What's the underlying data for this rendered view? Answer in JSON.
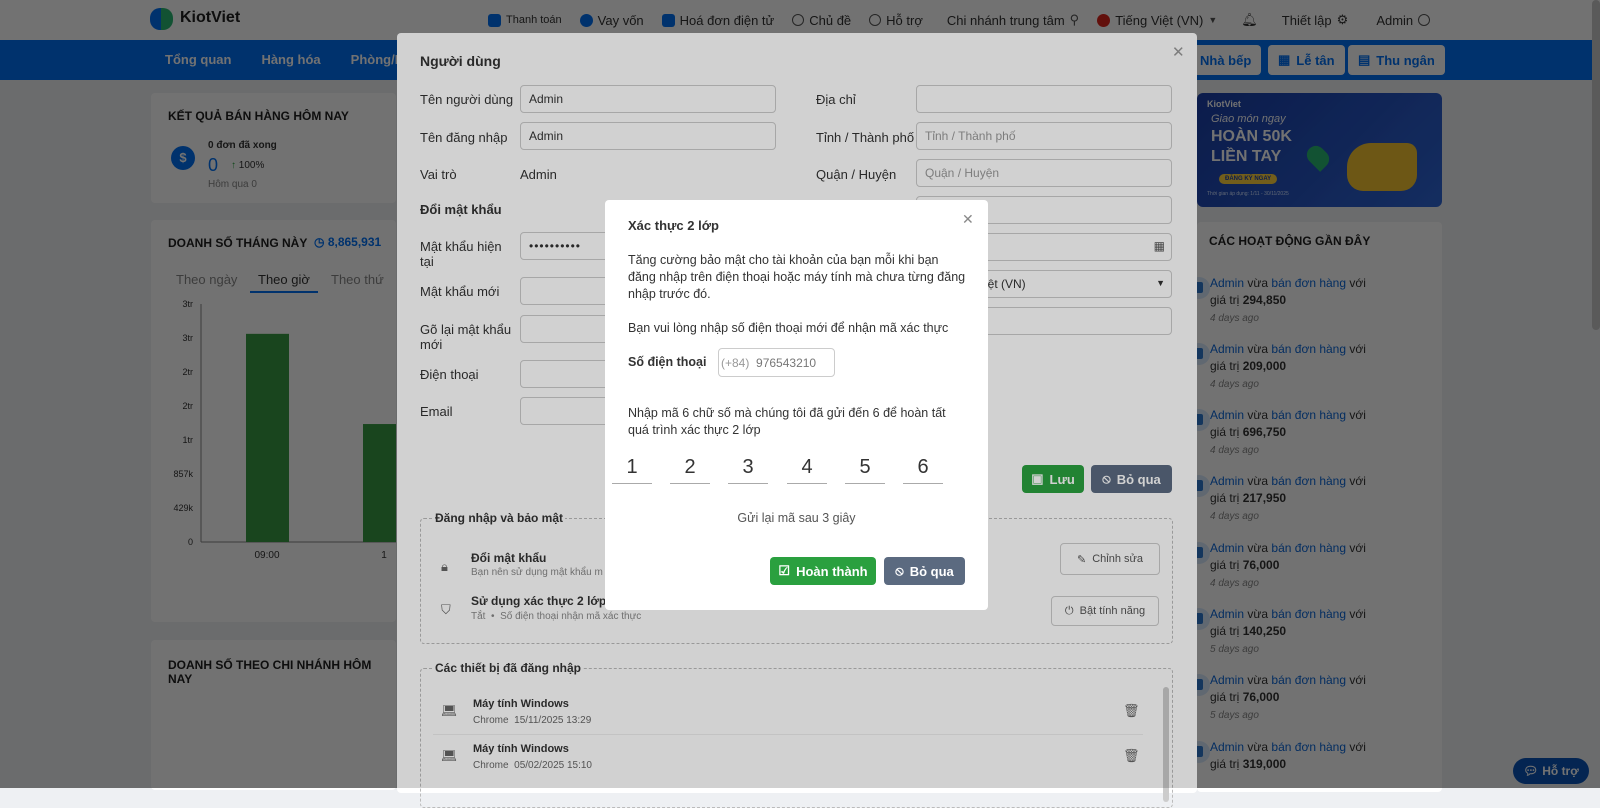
{
  "header": {
    "brand": "KiotViet",
    "nav": [
      "Thanh toán",
      "Vay vốn",
      "Hoá đơn điện tử",
      "Chủ đề",
      "Hỗ trợ",
      "Chi nhánh trung tâm",
      "Tiếng Việt (VN)",
      "Thiết lập",
      "Admin"
    ]
  },
  "mainbar": {
    "menu": [
      "Tổng quan",
      "Hàng hóa",
      "Phòng/Bàn"
    ],
    "buttons": [
      "Nhà bếp",
      "Lễ tân",
      "Thu ngân"
    ]
  },
  "sales_today": {
    "title": "KẾT QUẢ BÁN HÀNG HÔM NAY",
    "orders": "0 đơn đã xong",
    "amount": "0",
    "pct": "100%",
    "yesterday": "Hôm qua 0"
  },
  "monthly": {
    "title": "DOANH SỐ THÁNG NÀY",
    "total": "8,865,931",
    "tabs": [
      "Theo ngày",
      "Theo giờ",
      "Theo thứ"
    ]
  },
  "chart_data": {
    "type": "bar",
    "categories": [
      "09:00",
      "1"
    ],
    "values": [
      3000000,
      1700000
    ],
    "yticks": [
      "0",
      "429k",
      "857k",
      "1tr",
      "2tr",
      "2tr",
      "3tr",
      "3tr"
    ],
    "ylim": [
      0,
      3430000
    ]
  },
  "branch": {
    "title": "DOANH SỐ THEO CHI NHÁNH HÔM NAY"
  },
  "promo": {
    "brand": "KiotViet",
    "line1": "Giao món ngay",
    "line2": "HOÀN 50K",
    "line3": "LIỀN TAY",
    "cta": "ĐĂNG KÝ NGAY",
    "note": "Thời gian áp dụng: 1/11 - 30/11/2025"
  },
  "activity": {
    "title": "CÁC HOẠT ĐỘNG GẦN ĐÂY",
    "items": [
      {
        "user": "Admin",
        "verb": "vừa",
        "link": "bán đơn hàng",
        "tail": "với",
        "price_lbl": "giá trị",
        "value": "294,850",
        "time": "4 days ago"
      },
      {
        "user": "Admin",
        "verb": "vừa",
        "link": "bán đơn hàng",
        "tail": "với",
        "price_lbl": "giá trị",
        "value": "209,000",
        "time": "4 days ago"
      },
      {
        "user": "Admin",
        "verb": "vừa",
        "link": "bán đơn hàng",
        "tail": "với",
        "price_lbl": "giá trị",
        "value": "696,750",
        "time": "4 days ago"
      },
      {
        "user": "Admin",
        "verb": "vừa",
        "link": "bán đơn hàng",
        "tail": "với",
        "price_lbl": "giá trị",
        "value": "217,950",
        "time": "4 days ago"
      },
      {
        "user": "Admin",
        "verb": "vừa",
        "link": "bán đơn hàng",
        "tail": "với",
        "price_lbl": "giá trị",
        "value": "76,000",
        "time": "4 days ago"
      },
      {
        "user": "Admin",
        "verb": "vừa",
        "link": "bán đơn hàng",
        "tail": "với",
        "price_lbl": "giá trị",
        "value": "140,250",
        "time": "5 days ago"
      },
      {
        "user": "Admin",
        "verb": "vừa",
        "link": "bán đơn hàng",
        "tail": "với",
        "price_lbl": "giá trị",
        "value": "76,000",
        "time": "5 days ago"
      },
      {
        "user": "Admin",
        "verb": "vừa",
        "link": "bán đơn hàng",
        "tail": "với",
        "price_lbl": "giá trị",
        "value": "319,000",
        "time": ""
      }
    ]
  },
  "panel": {
    "title": "Người dùng",
    "username_lbl": "Tên người dùng",
    "username": "Admin",
    "login_lbl": "Tên đăng nhập",
    "login": "Admin",
    "role_lbl": "Vai trò",
    "role": "Admin",
    "change_pw_lbl": "Đổi mật khẩu",
    "cur_pw_lbl": "Mật khẩu hiện tại",
    "cur_pw": "••••••••••",
    "new_pw_lbl": "Mật khẩu mới",
    "re_pw_lbl": "Gõ lại mật khẩu mới",
    "phone_lbl": "Điện thoại",
    "email_lbl": "Email",
    "address_lbl": "Địa chỉ",
    "city_lbl": "Tỉnh / Thành phố",
    "city_ph": "Tỉnh / Thành phố",
    "district_lbl": "Quận / Huyện",
    "district_ph": "Quận / Huyện",
    "lang_partial": "iệt (VN)",
    "save": "Lưu",
    "skip": "Bỏ qua",
    "sec_title": "Đăng nhập và bảo mật",
    "pw_row_title": "Đổi mật khẩu",
    "pw_row_sub": "Bạn nên sử dụng mật khẩu m",
    "edit": "Chỉnh sửa",
    "tfa_row_title": "Sử dụng xác thực 2 lớp",
    "tfa_off": "Tắt",
    "tfa_sub": "Số điện thoại nhận mã xác thực",
    "enable": "Bật tính năng",
    "devices_title": "Các thiết bị đã đăng nhập",
    "devices": [
      {
        "name": "Máy tính Windows",
        "browser": "Chrome",
        "date": "15/11/2025 13:29"
      },
      {
        "name": "Máy tính Windows",
        "browser": "Chrome",
        "date": "05/02/2025 15:10"
      }
    ]
  },
  "dialog": {
    "title": "Xác thực 2 lớp",
    "desc": "Tăng cường bảo mật cho tài khoản của bạn mỗi khi bạn đăng nhập trên điện thoại hoặc máy tính mà chưa từng đăng nhập trước đó.",
    "phone_prompt": "Bạn vui lòng nhập số điện thoại mới để nhận mã xác thực",
    "phone_lbl": "Số điện thoại",
    "phone_prefix": "(+84)",
    "phone_ph": "976543210",
    "code_prompt": "Nhập mã 6 chữ số mà chúng tôi đã gửi đến 6 để hoàn tất quá trình xác thực 2 lớp",
    "digits": [
      "1",
      "2",
      "3",
      "4",
      "5",
      "6"
    ],
    "resend": "Gửi lại mã sau 3 giây",
    "done": "Hoàn thành",
    "skip": "Bỏ qua"
  },
  "help": "Hỗ trợ"
}
